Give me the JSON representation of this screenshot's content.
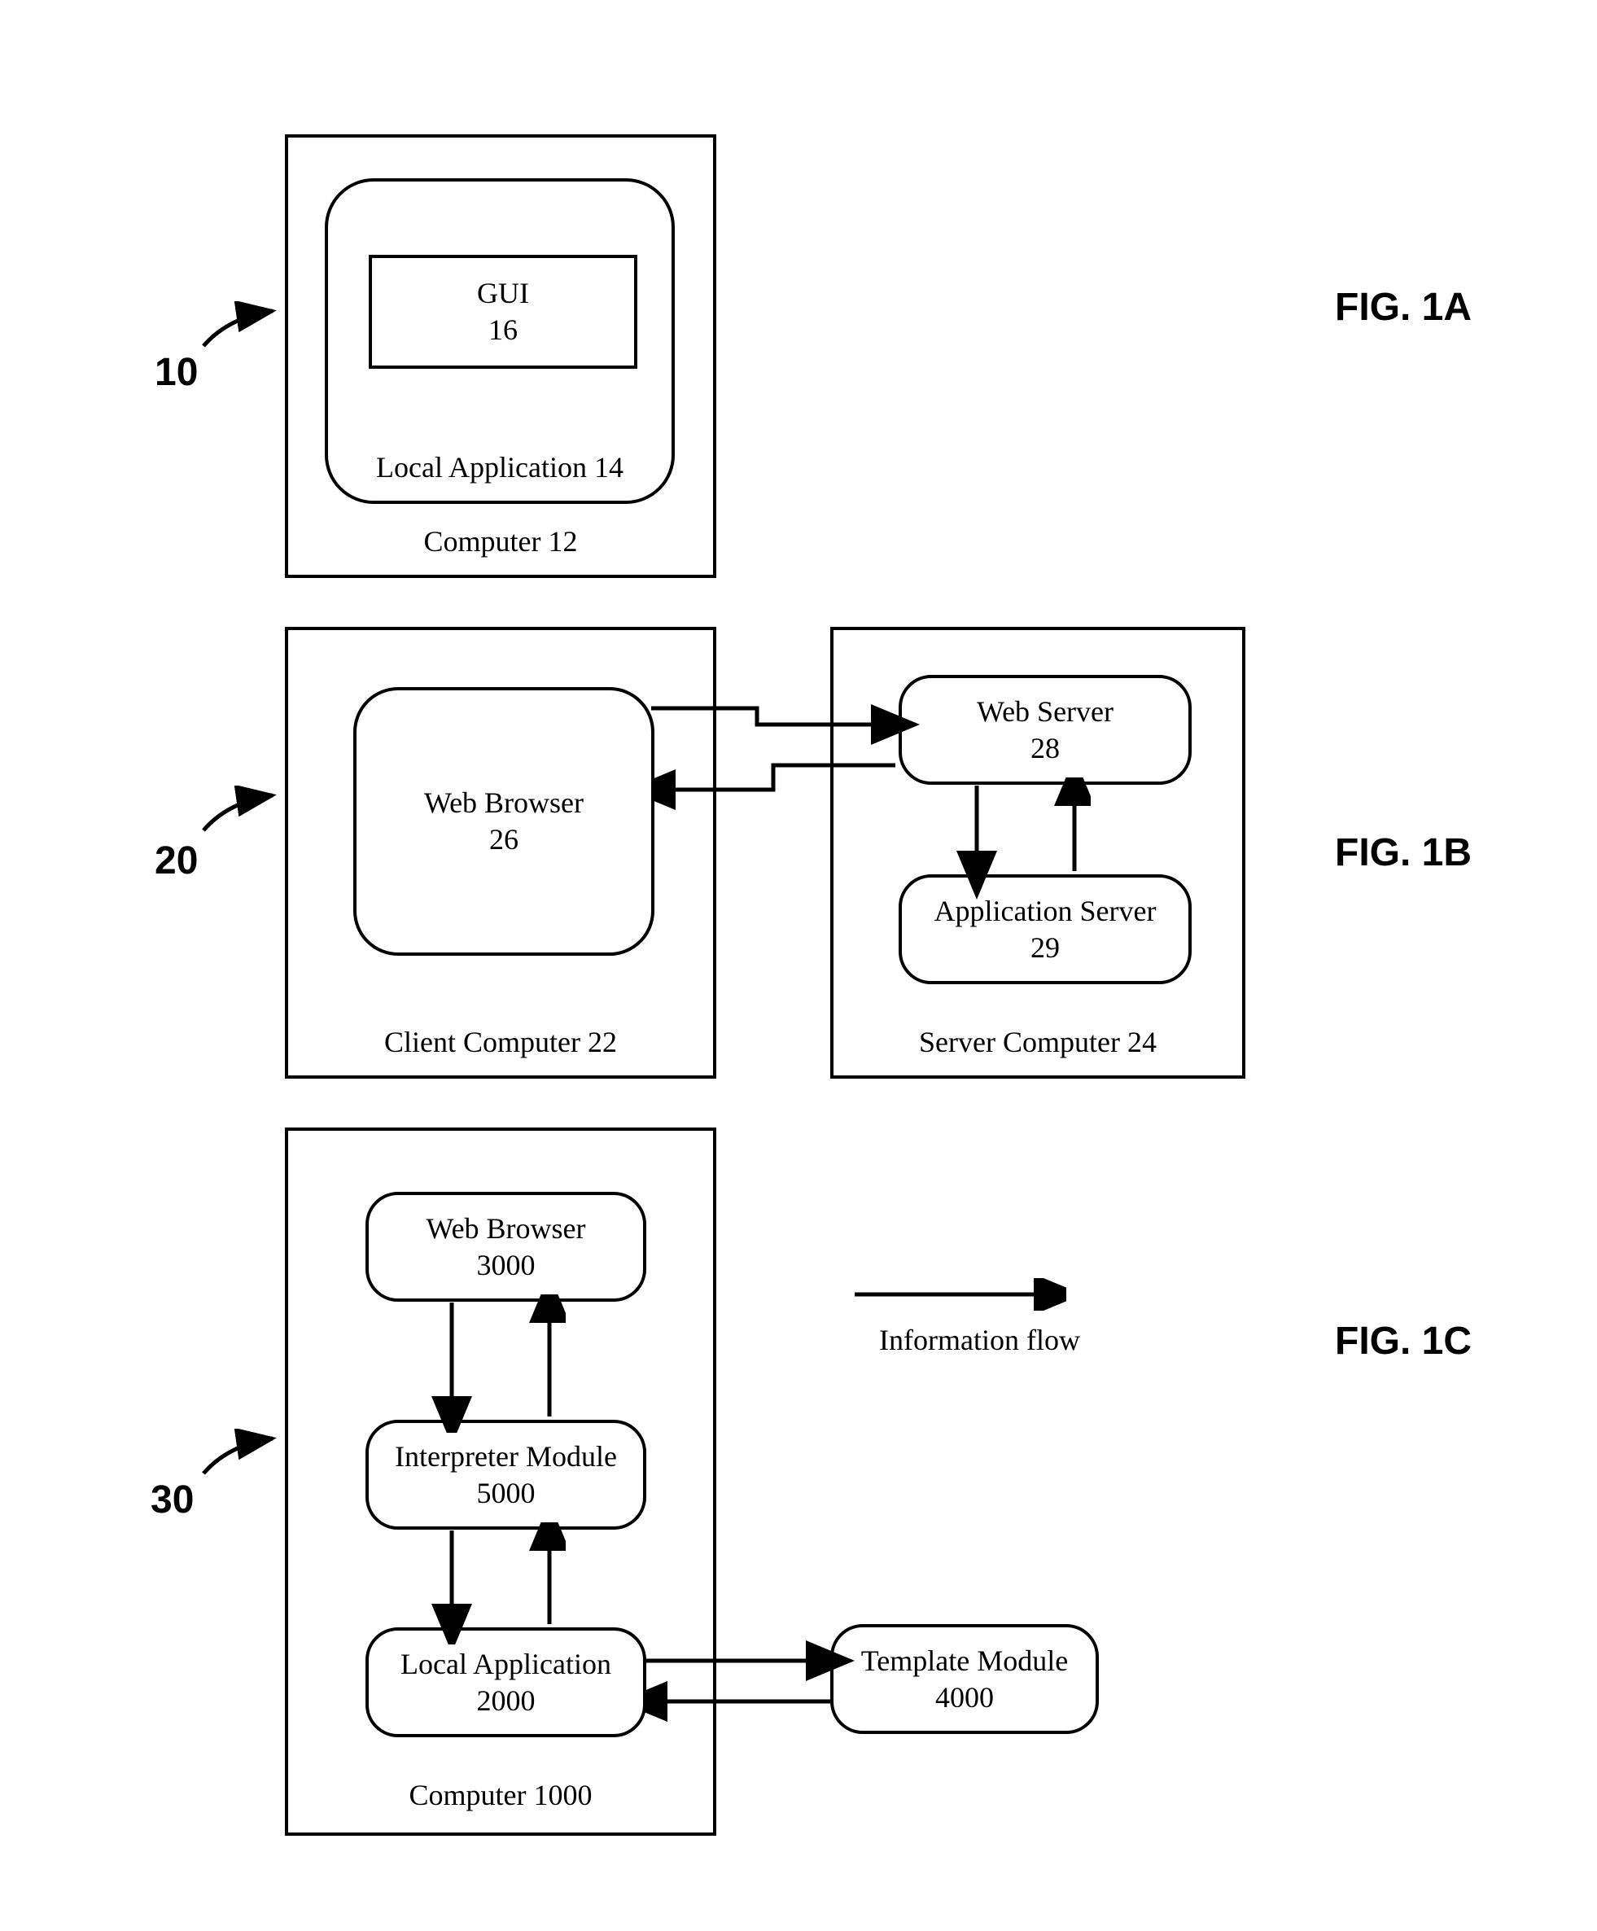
{
  "figA": {
    "ref": "10",
    "title": "FIG. 1A",
    "computer_label": "Computer 12",
    "local_app_label": "Local Application 14",
    "gui_label1": "GUI",
    "gui_label2": "16"
  },
  "figB": {
    "ref": "20",
    "title": "FIG. 1B",
    "client_label": "Client Computer 22",
    "server_label": "Server Computer 24",
    "browser_label1": "Web Browser",
    "browser_label2": "26",
    "webserver_label1": "Web Server",
    "webserver_label2": "28",
    "appserver_label1": "Application Server",
    "appserver_label2": "29"
  },
  "figC": {
    "ref": "30",
    "title": "FIG. 1C",
    "computer_label": "Computer 1000",
    "browser_label1": "Web Browser",
    "browser_label2": "3000",
    "interpreter_label1": "Interpreter Module",
    "interpreter_label2": "5000",
    "localapp_label1": "Local Application",
    "localapp_label2": "2000",
    "template_label1": "Template Module",
    "template_label2": "4000",
    "legend": "Information flow"
  }
}
